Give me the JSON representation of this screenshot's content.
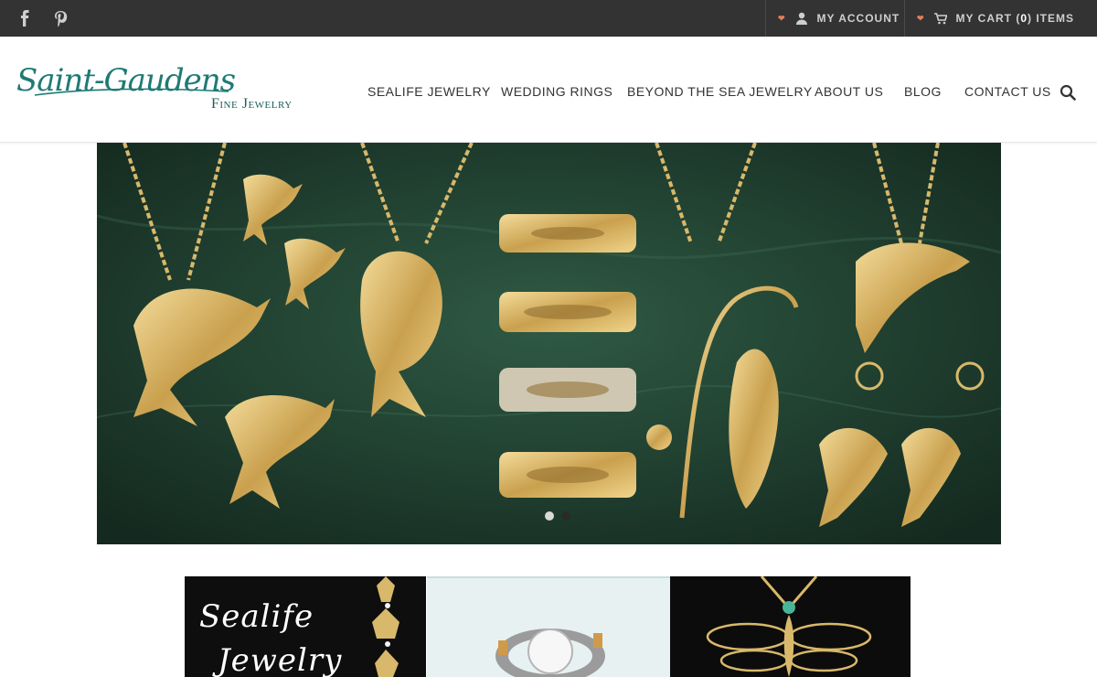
{
  "social": [
    "facebook-icon",
    "pinterest-icon"
  ],
  "account": {
    "label": "MY ACCOUNT"
  },
  "cart": {
    "prefix": "MY CART (",
    "count": "0",
    "suffix": ") ITEMS"
  },
  "logo": {
    "script": "Saint-Gaudens",
    "sub": "Fine Jewelry"
  },
  "nav": {
    "items": [
      {
        "label": "SEALIFE JEWELRY"
      },
      {
        "label": "WEDDING RINGS"
      },
      {
        "label": "BEYOND THE SEA JEWELRY"
      },
      {
        "label": "ABOUT US"
      },
      {
        "label": "BLOG"
      },
      {
        "label": "CONTACT US"
      }
    ]
  },
  "hero": {
    "slide_count": 2,
    "active_slide": 1
  },
  "tiles": [
    {
      "line1": "Sealife",
      "line2": "Jewelry"
    },
    {
      "line1": ""
    },
    {
      "line1": ""
    }
  ],
  "colors": {
    "topbar": "#333333",
    "brand": "#1f7a74",
    "caret": "#e0805a",
    "gold": "#d8b86a"
  }
}
